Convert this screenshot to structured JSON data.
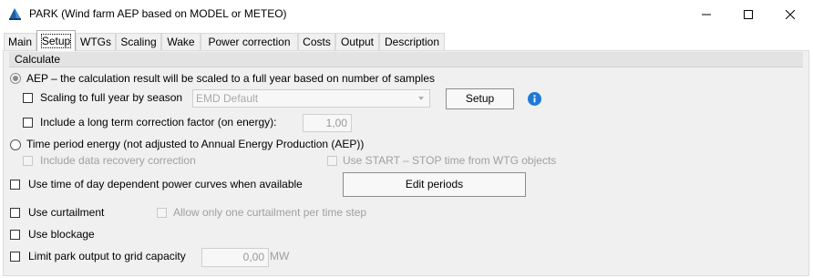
{
  "window": {
    "title": "PARK (Wind farm AEP based on MODEL or METEO)",
    "minimize_icon": "minimize-icon",
    "maximize_icon": "maximize-icon",
    "close_icon": "close-icon"
  },
  "tabs": [
    {
      "label": "Main",
      "active": false
    },
    {
      "label": "Setup",
      "active": true
    },
    {
      "label": "WTGs",
      "active": false
    },
    {
      "label": "Scaling",
      "active": false
    },
    {
      "label": "Wake",
      "active": false
    },
    {
      "label": "Power correction",
      "active": false
    },
    {
      "label": "Costs",
      "active": false
    },
    {
      "label": "Output",
      "active": false
    },
    {
      "label": "Description",
      "active": false
    }
  ],
  "calculate": {
    "title": "Calculate",
    "aep_radio": {
      "label": "AEP – the calculation result will be scaled to a full year based on number of samples",
      "selected": true
    },
    "scaling_by_season": {
      "label": "Scaling to full year by season",
      "checked": false
    },
    "season_combo": {
      "value": "EMD Default"
    },
    "setup_button": "Setup",
    "long_term": {
      "label": "Include a long term correction factor (on energy):",
      "checked": false,
      "value": "1,00"
    },
    "time_period_radio": {
      "label": "Time period energy (not adjusted to Annual Energy Production (AEP))",
      "selected": false
    },
    "data_recovery": {
      "label": "Include data recovery correction",
      "checked": false
    },
    "start_stop": {
      "label": "Use START – STOP time from WTG objects",
      "checked": false
    },
    "time_of_day": {
      "label": "Use time of day dependent power curves when available",
      "checked": false
    },
    "edit_periods_button": "Edit periods",
    "curtailment": {
      "label": "Use curtailment",
      "checked": false
    },
    "one_curtailment": {
      "label": "Allow only one curtailment per time step",
      "checked": false
    },
    "blockage": {
      "label": "Use blockage",
      "checked": false
    },
    "grid_capacity": {
      "label": "Limit park output to grid capacity",
      "checked": false,
      "value": "0,00",
      "unit": "MW"
    }
  },
  "colors": {
    "info": "#1e7ad6",
    "disabled_text": "#a0a0a0",
    "panel": "#f0f0f0"
  }
}
